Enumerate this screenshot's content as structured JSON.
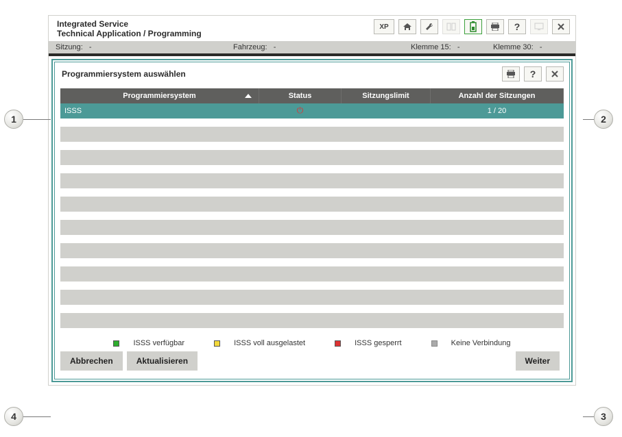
{
  "header": {
    "line1": "Integrated Service",
    "line2": "Technical Application / Programming",
    "toolbar": {
      "xp": "XP"
    }
  },
  "statusbar": {
    "sitzung_label": "Sitzung:",
    "sitzung_value": "-",
    "fahrzeug_label": "Fahrzeug:",
    "fahrzeug_value": "-",
    "klemme15_label": "Klemme 15:",
    "klemme15_value": "-",
    "klemme30_label": "Klemme 30:",
    "klemme30_value": "-"
  },
  "dialog": {
    "title": "Programmiersystem auswählen",
    "columns": {
      "system": "Programmiersystem",
      "status": "Status",
      "limit": "Sitzungslimit",
      "count": "Anzahl der Sitzungen"
    },
    "rows": [
      {
        "system": "ISSS",
        "status": "locked",
        "limit": "",
        "count": "1 / 20",
        "selected": true
      }
    ],
    "legend": {
      "available": "ISSS verfügbar",
      "full": "ISSS voll ausgelastet",
      "locked": "ISSS gesperrt",
      "noconn": "Keine Verbindung"
    },
    "buttons": {
      "cancel": "Abbrechen",
      "refresh": "Aktualisieren",
      "next": "Weiter"
    }
  },
  "callouts": {
    "c1": "1",
    "c2": "2",
    "c3": "3",
    "c4": "4"
  }
}
